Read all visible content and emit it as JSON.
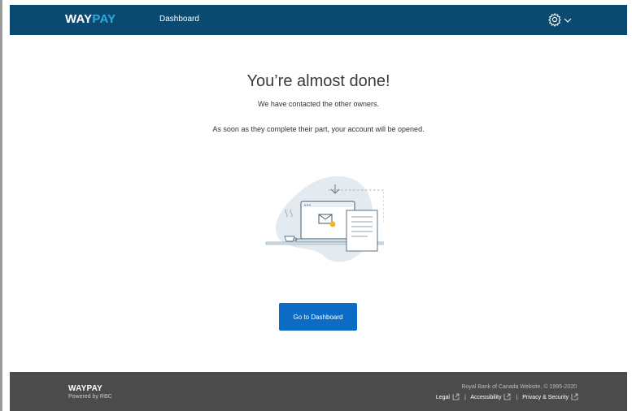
{
  "header": {
    "logo_way": "WAY",
    "logo_pay": "PAY",
    "nav_dashboard": "Dashboard",
    "settings_icon": "gear-icon",
    "chevron_icon": "chevron-down-icon"
  },
  "main": {
    "title": "You’re almost done!",
    "subtitle": "We have contacted the other owners.",
    "message": "As soon as they complete their part, your account will be opened.",
    "illustration_icon": "laptop-email-document-illustration",
    "cta_label": "Go to Dashboard"
  },
  "footer": {
    "logo": "WAYPAY",
    "powered_by": "Powered by RBC",
    "copyright": "Royal Bank of Canada Website, © 1995-2020",
    "links": [
      "Legal",
      "Accessibility",
      "Privacy & Security"
    ],
    "separator": "|",
    "external_icon": "external-link-icon"
  },
  "colors": {
    "header_bg": "#0b4a70",
    "logo_accent": "#2fa9e0",
    "primary_button": "#0b6bc5",
    "footer_bg": "#4b4b4b"
  }
}
